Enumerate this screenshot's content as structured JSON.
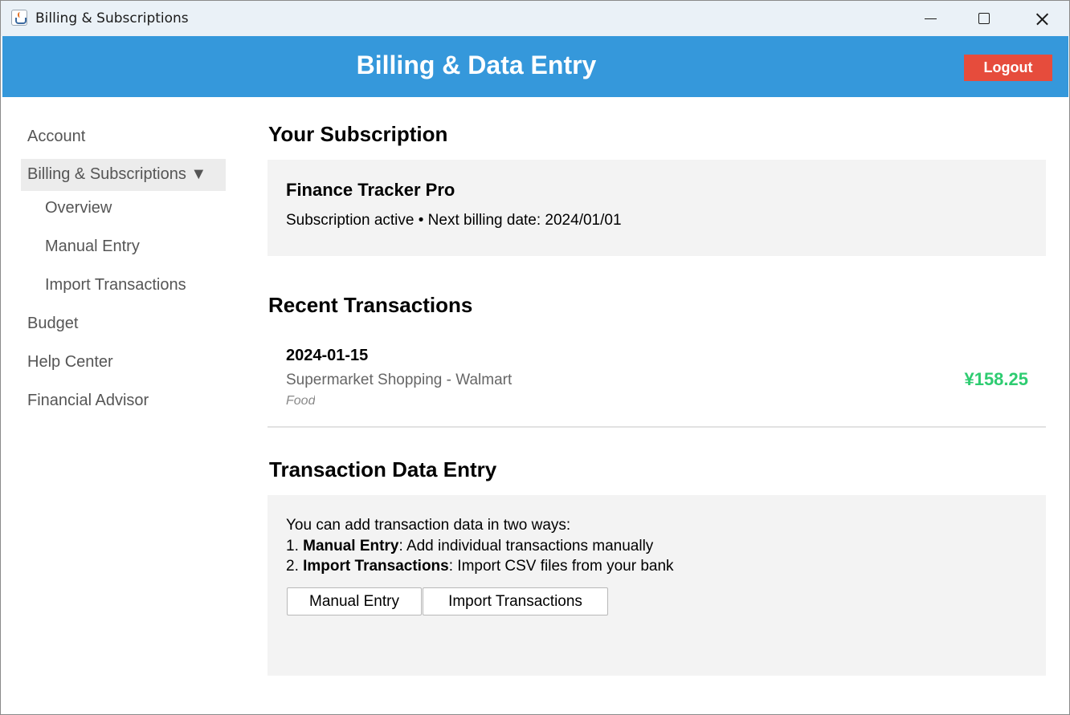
{
  "window": {
    "title": "Billing & Subscriptions"
  },
  "header": {
    "title": "Billing & Data Entry",
    "logout_label": "Logout"
  },
  "sidebar": {
    "items": [
      {
        "label": "Account"
      },
      {
        "label": "Billing & Subscriptions ▼",
        "expanded": true
      },
      {
        "label": "Overview"
      },
      {
        "label": "Manual Entry"
      },
      {
        "label": "Import Transactions"
      },
      {
        "label": "Budget"
      },
      {
        "label": "Help Center"
      },
      {
        "label": "Financial Advisor"
      }
    ]
  },
  "subscription": {
    "heading": "Your Subscription",
    "plan_name": "Finance Tracker Pro",
    "status": "Subscription active • Next billing date: 2024/01/01"
  },
  "transactions": {
    "heading": "Recent Transactions",
    "items": [
      {
        "date": "2024-01-15",
        "description": "Supermarket Shopping - Walmart",
        "category": "Food",
        "amount": "¥158.25"
      }
    ]
  },
  "data_entry": {
    "heading": "Transaction Data Entry",
    "intro": "You can add transaction data in two ways:",
    "line1_prefix": "1. ",
    "line1_bold": "Manual Entry",
    "line1_rest": ": Add individual transactions manually",
    "line2_prefix": "2. ",
    "line2_bold": "Import Transactions",
    "line2_rest": ": Import CSV files from your bank",
    "manual_button": "Manual Entry",
    "import_button": "Import Transactions"
  },
  "colors": {
    "header_bg": "#3598db",
    "logout_bg": "#e64c3c",
    "amount_positive": "#2ecc71",
    "card_bg": "#f3f3f3"
  },
  "icons": {
    "app": "java-cup-icon",
    "minimize": "minimize-icon",
    "maximize": "maximize-icon",
    "close": "close-icon"
  }
}
